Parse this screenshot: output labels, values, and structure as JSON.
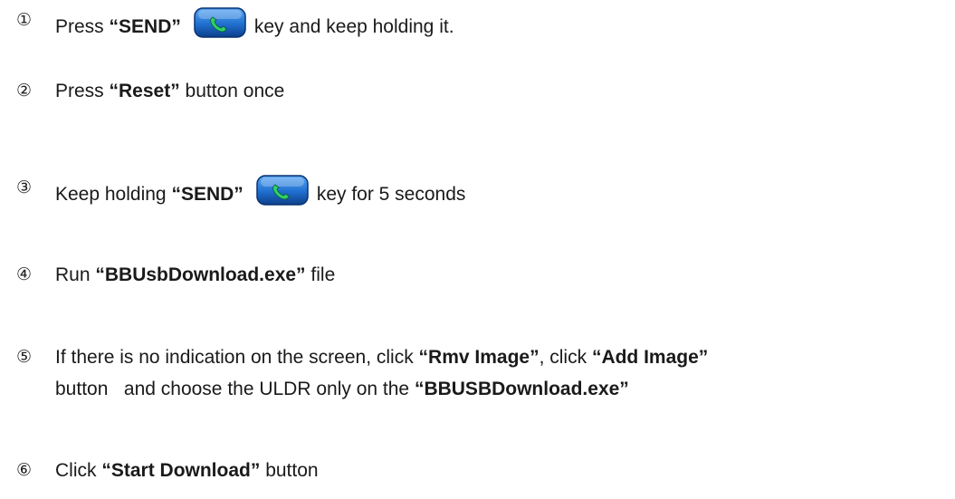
{
  "steps": [
    {
      "num": "①",
      "parts": [
        {
          "text": "Press ",
          "bold": false
        },
        {
          "text": "“SEND”",
          "bold": true
        },
        {
          "icon": "send-key-icon"
        },
        {
          "text": "key and keep holding it.",
          "bold": false
        }
      ]
    },
    {
      "num": "②",
      "parts": [
        {
          "text": "Press ",
          "bold": false
        },
        {
          "text": "“Reset”",
          "bold": true
        },
        {
          "text": " button once",
          "bold": false
        }
      ]
    },
    {
      "num": "③",
      "parts": [
        {
          "text": "Keep holding ",
          "bold": false
        },
        {
          "text": "“SEND”",
          "bold": true
        },
        {
          "icon": "send-key-icon"
        },
        {
          "text": "key for 5 seconds",
          "bold": false
        }
      ]
    },
    {
      "num": "④",
      "parts": [
        {
          "text": "Run ",
          "bold": false
        },
        {
          "text": "“BBUsbDownload.exe”",
          "bold": true
        },
        {
          "text": " file",
          "bold": false
        }
      ]
    },
    {
      "num": "⑤",
      "parts": [
        {
          "text": "If there is no indication on the screen, click ",
          "bold": false
        },
        {
          "text": "“Rmv Image”",
          "bold": true
        },
        {
          "text": ", click ",
          "bold": false
        },
        {
          "text": "“Add Image”",
          "bold": true
        }
      ],
      "parts2": [
        {
          "text": "button   and choose the ULDR only on the ",
          "bold": false
        },
        {
          "text": "“BBUSBDownload.exe”",
          "bold": true
        }
      ]
    },
    {
      "num": "⑥",
      "parts": [
        {
          "text": "Click ",
          "bold": false
        },
        {
          "text": "“Start Download”",
          "bold": true
        },
        {
          "text": " button",
          "bold": false
        }
      ]
    }
  ],
  "colors": {
    "key_body": "#1f6fd0",
    "key_highlight": "#5aa6f2",
    "key_handset": "#2fd06a"
  }
}
